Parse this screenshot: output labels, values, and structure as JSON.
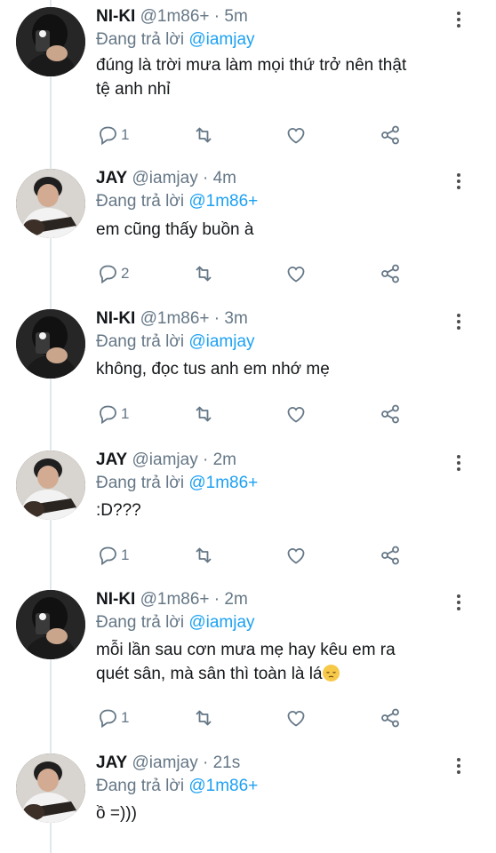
{
  "tweets": [
    {
      "name": "NI-KI",
      "handle": "@1m86+",
      "time": "5m",
      "reply_prefix": "Đang trả lời",
      "reply_to": "@iamjay",
      "text": [
        "đúng là trời mưa làm mọi thứ trở nên thật",
        "tệ anh nhỉ"
      ],
      "reply_count": "1",
      "avatar": "niki-avatar"
    },
    {
      "name": "JAY",
      "handle": "@iamjay",
      "time": "4m",
      "reply_prefix": "Đang trả lời",
      "reply_to": "@1m86+",
      "text": [
        "em cũng thấy buồn à"
      ],
      "reply_count": "2",
      "avatar": "jay-avatar"
    },
    {
      "name": "NI-KI",
      "handle": "@1m86+",
      "time": "3m",
      "reply_prefix": "Đang trả lời",
      "reply_to": "@iamjay",
      "text": [
        "không, đọc tus anh em nhớ mẹ"
      ],
      "reply_count": "1",
      "avatar": "niki-avatar"
    },
    {
      "name": "JAY",
      "handle": "@iamjay",
      "time": "2m",
      "reply_prefix": "Đang trả lời",
      "reply_to": "@1m86+",
      "text": [
        ":D???"
      ],
      "reply_count": "1",
      "avatar": "jay-avatar"
    },
    {
      "name": "NI-KI",
      "handle": "@1m86+",
      "time": "2m",
      "reply_prefix": "Đang trả lời",
      "reply_to": "@iamjay",
      "text": [
        "mỗi lần sau cơn mưa mẹ hay kêu em ra",
        "quét sân, mà sân thì toàn là lá"
      ],
      "reply_count": "1",
      "avatar": "niki-avatar",
      "trailing_emoji": "pensive-face"
    },
    {
      "name": "JAY",
      "handle": "@iamjay",
      "time": "21s",
      "reply_prefix": "Đang trả lời",
      "reply_to": "@1m86+",
      "text": [
        "ồ =)))"
      ],
      "avatar": "jay-avatar"
    }
  ],
  "separator": " · ",
  "icons": {
    "reply": "reply-icon",
    "retweet": "retweet-icon",
    "like": "heart-icon",
    "share": "share-icon",
    "more": "more-vertical-icon"
  },
  "colors": {
    "mention": "#1da1f2",
    "secondary": "#657786",
    "icon": "#657786"
  }
}
